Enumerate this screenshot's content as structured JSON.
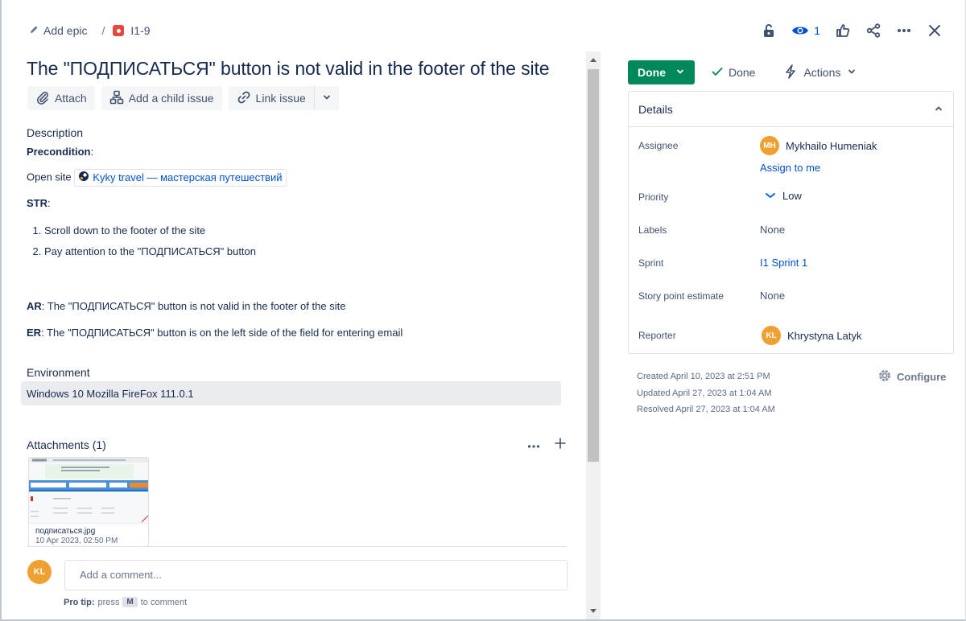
{
  "header": {
    "add_epic": "Add epic",
    "separator": "/",
    "issue_key": "I1-9",
    "watch_count": "1"
  },
  "issue": {
    "title": "The \"ПОДПИСАТЬСЯ\" button is not valid in the footer of the site"
  },
  "actions": {
    "attach": "Attach",
    "add_child": "Add a child issue",
    "link_issue": "Link issue"
  },
  "description": {
    "label": "Description",
    "precondition_label": "Precondition",
    "precondition_colon": ":",
    "open_site": "Open site",
    "site_link": "Kyky travel — мастерская путешествий",
    "str_label": "STR",
    "str_colon": ":",
    "steps": [
      "Scroll down to the footer of the site",
      "Pay attention to the \"ПОДПИСАТЬСЯ\" button"
    ],
    "ar_label": "AR",
    "ar_text": ": The \"ПОДПИСАТЬСЯ\" button is not valid in the footer of the site",
    "er_label": "ER",
    "er_text": ": The \"ПОДПИСАТЬСЯ\" button is on the left side of the field for entering email"
  },
  "environment": {
    "label": "Environment",
    "value": "Windows 10  Mozilla FireFox 111.0.1"
  },
  "attachments": {
    "label": "Attachments (1)",
    "file_name": "подписаться.jpg",
    "file_date": "10 Apr 2023, 02:50 PM"
  },
  "comment": {
    "avatar": "KL",
    "placeholder": "Add a comment...",
    "pro_tip_label": "Pro tip:",
    "pro_tip_press": "press",
    "pro_tip_key": "M",
    "pro_tip_text": "to comment"
  },
  "status": {
    "button": "Done",
    "resolution": "Done",
    "actions": "Actions"
  },
  "details": {
    "title": "Details",
    "assignee_label": "Assignee",
    "assignee_initials": "MH",
    "assignee_name": "Mykhailo Humeniak",
    "assign_to_me": "Assign to me",
    "priority_label": "Priority",
    "priority_value": "Low",
    "labels_label": "Labels",
    "labels_value": "None",
    "sprint_label": "Sprint",
    "sprint_value": "I1 Sprint 1",
    "story_label": "Story point estimate",
    "story_value": "None",
    "reporter_label": "Reporter",
    "reporter_initials": "KL",
    "reporter_name": "Khrystyna Latyk"
  },
  "meta": {
    "created": "Created April 10, 2023 at 2:51 PM",
    "updated": "Updated April 27, 2023 at 1:04 AM",
    "resolved": "Resolved April 27, 2023 at 1:04 AM",
    "configure": "Configure"
  },
  "colors": {
    "done_green": "#00875a",
    "link_blue": "#0052cc",
    "avatar_orange": "#f0a030",
    "bug_red": "#e5493a"
  }
}
